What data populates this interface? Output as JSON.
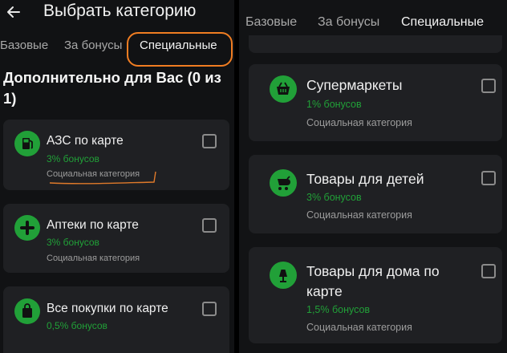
{
  "left": {
    "header": {
      "title": "Выбрать категорию"
    },
    "tabs": [
      {
        "label": "Базовые"
      },
      {
        "label": "За бонусы"
      },
      {
        "label": "Специальные"
      }
    ],
    "section_title": "Дополнительно для Вас (0 из 1)",
    "cards": [
      {
        "title": "АЗС по карте",
        "bonus": "3% бонусов",
        "subtitle": "Социальная категория",
        "icon": "fuel-pump-icon"
      },
      {
        "title": "Аптеки по карте",
        "bonus": "3% бонусов",
        "subtitle": "Социальная категория",
        "icon": "pharmacy-cross-icon"
      },
      {
        "title": "Все покупки по карте",
        "bonus": "0,5% бонусов",
        "subtitle": "",
        "icon": "shopping-bag-icon"
      }
    ]
  },
  "right": {
    "tabs": [
      {
        "label": "Базовые"
      },
      {
        "label": "За бонусы"
      },
      {
        "label": "Специальные"
      }
    ],
    "cards": [
      {
        "title": "Супермаркеты",
        "bonus": "1% бонусов",
        "subtitle": "Социальная категория",
        "icon": "shopping-basket-icon"
      },
      {
        "title": "Товары для детей",
        "bonus": "3% бонусов",
        "subtitle": "Социальная категория",
        "icon": "baby-stroller-icon"
      },
      {
        "title_line1": "Товары для дома по",
        "title_line2": "карте",
        "bonus": "1,5% бонусов",
        "subtitle": "Социальная категория",
        "icon": "lamp-icon"
      }
    ]
  },
  "colors": {
    "background": "#111214",
    "card": "#1f2023",
    "accent_green": "#21a038",
    "highlight_orange": "#f07d22"
  }
}
